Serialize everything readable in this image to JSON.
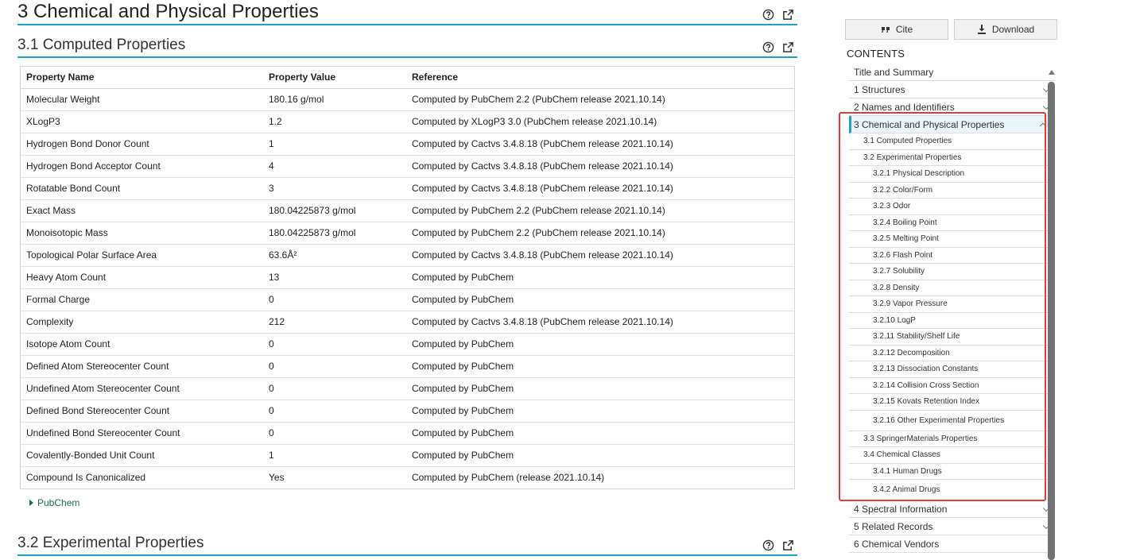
{
  "section_title": "3 Chemical and Physical Properties",
  "subsection_computed_title": "3.1 Computed Properties",
  "subsection_experimental_title": "3.2 Experimental Properties",
  "table": {
    "headers": [
      "Property Name",
      "Property Value",
      "Reference"
    ],
    "rows": [
      [
        "Molecular Weight",
        "180.16 g/mol",
        "Computed by PubChem 2.2 (PubChem release 2021.10.14)"
      ],
      [
        "XLogP3",
        "1.2",
        "Computed by XLogP3 3.0 (PubChem release 2021.10.14)"
      ],
      [
        "Hydrogen Bond Donor Count",
        "1",
        "Computed by Cactvs 3.4.8.18 (PubChem release 2021.10.14)"
      ],
      [
        "Hydrogen Bond Acceptor Count",
        "4",
        "Computed by Cactvs 3.4.8.18 (PubChem release 2021.10.14)"
      ],
      [
        "Rotatable Bond Count",
        "3",
        "Computed by Cactvs 3.4.8.18 (PubChem release 2021.10.14)"
      ],
      [
        "Exact Mass",
        "180.04225873 g/mol",
        "Computed by PubChem 2.2 (PubChem release 2021.10.14)"
      ],
      [
        "Monoisotopic Mass",
        "180.04225873 g/mol",
        "Computed by PubChem 2.2 (PubChem release 2021.10.14)"
      ],
      [
        "Topological Polar Surface Area",
        "63.6Å²",
        "Computed by Cactvs 3.4.8.18 (PubChem release 2021.10.14)"
      ],
      [
        "Heavy Atom Count",
        "13",
        "Computed by PubChem"
      ],
      [
        "Formal Charge",
        "0",
        "Computed by PubChem"
      ],
      [
        "Complexity",
        "212",
        "Computed by Cactvs 3.4.8.18 (PubChem release 2021.10.14)"
      ],
      [
        "Isotope Atom Count",
        "0",
        "Computed by PubChem"
      ],
      [
        "Defined Atom Stereocenter Count",
        "0",
        "Computed by PubChem"
      ],
      [
        "Undefined Atom Stereocenter Count",
        "0",
        "Computed by PubChem"
      ],
      [
        "Defined Bond Stereocenter Count",
        "0",
        "Computed by PubChem"
      ],
      [
        "Undefined Bond Stereocenter Count",
        "0",
        "Computed by PubChem"
      ],
      [
        "Covalently-Bonded Unit Count",
        "1",
        "Computed by PubChem"
      ],
      [
        "Compound Is Canonicalized",
        "Yes",
        "Computed by PubChem (release 2021.10.14)"
      ]
    ]
  },
  "source_link_label": "PubChem",
  "sidebar": {
    "cite_label": "Cite",
    "download_label": "Download",
    "contents_title": "CONTENTS",
    "toc": [
      {
        "label": "Title and Summary",
        "level": 0,
        "chevron": ""
      },
      {
        "label": "1 Structures",
        "level": 0,
        "chevron": "down"
      },
      {
        "label": "2 Names and Identifiers",
        "level": 0,
        "chevron": "down"
      },
      {
        "label": "3 Chemical and Physical Properties",
        "level": 0,
        "chevron": "up",
        "active": true
      },
      {
        "label": "3.1 Computed Properties",
        "level": 1
      },
      {
        "label": "3.2 Experimental Properties",
        "level": 1
      },
      {
        "label": "3.2.1 Physical Description",
        "level": 2
      },
      {
        "label": "3.2.2 Color/Form",
        "level": 2
      },
      {
        "label": "3.2.3 Odor",
        "level": 2
      },
      {
        "label": "3.2.4 Boiling Point",
        "level": 2
      },
      {
        "label": "3.2.5 Melting Point",
        "level": 2
      },
      {
        "label": "3.2.6 Flash Point",
        "level": 2
      },
      {
        "label": "3.2.7 Solubility",
        "level": 2
      },
      {
        "label": "3.2.8 Density",
        "level": 2
      },
      {
        "label": "3.2.9 Vapor Pressure",
        "level": 2
      },
      {
        "label": "3.2.10 LogP",
        "level": 2
      },
      {
        "label": "3.2.11 Stability/Shelf Life",
        "level": 2
      },
      {
        "label": "3.2.12 Decomposition",
        "level": 2
      },
      {
        "label": "3.2.13 Dissociation Constants",
        "level": 2
      },
      {
        "label": "3.2.14 Collision Cross Section",
        "level": 2
      },
      {
        "label": "3.2.15 Kovats Retention Index",
        "level": 2
      },
      {
        "label": "3.2.16 Other Experimental Properties",
        "level": 2,
        "tall": true
      },
      {
        "label": "3.3 SpringerMaterials Properties",
        "level": 1
      },
      {
        "label": "3.4 Chemical Classes",
        "level": 1
      },
      {
        "label": "3.4.1 Human Drugs",
        "level": 2
      },
      {
        "label": "3.4.2 Animal Drugs",
        "level": 2,
        "tall": true
      },
      {
        "label": "4 Spectral Information",
        "level": 0,
        "chevron": "down"
      },
      {
        "label": "5 Related Records",
        "level": 0,
        "chevron": "down"
      },
      {
        "label": "6 Chemical Vendors",
        "level": 0,
        "chevron": ""
      }
    ]
  },
  "colors": {
    "accent": "#21a0d2",
    "highlight": "#e53935",
    "link": "#1b6f58"
  }
}
